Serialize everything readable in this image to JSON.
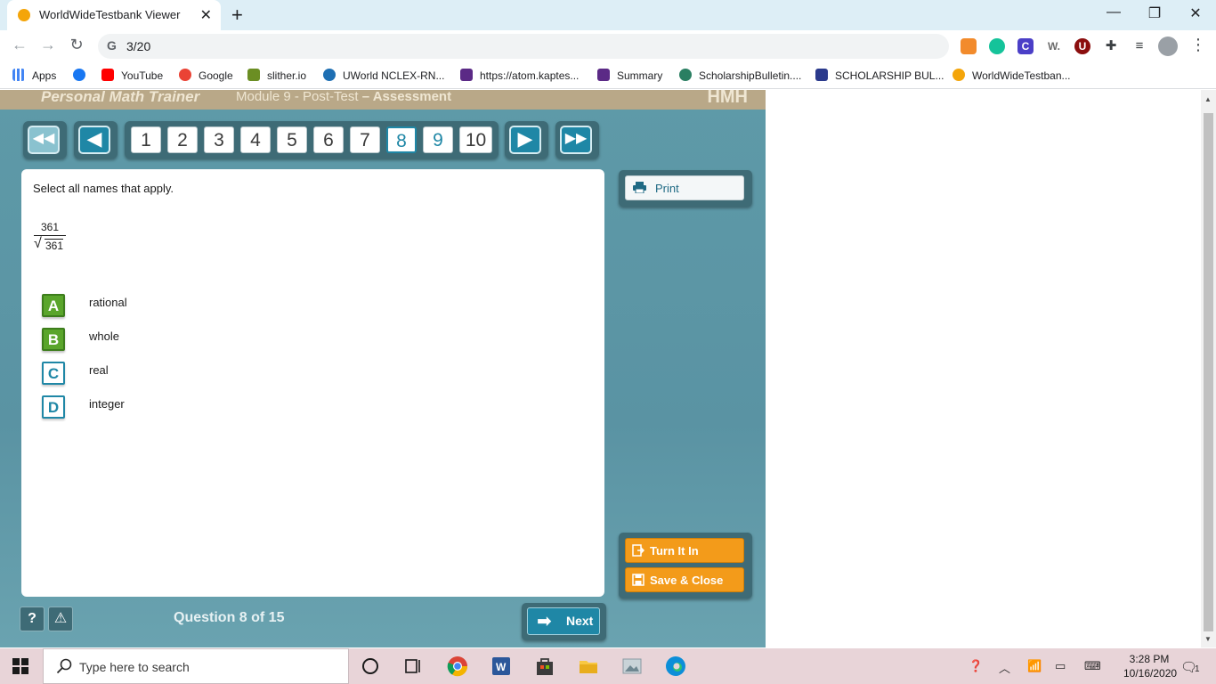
{
  "browser": {
    "tab_title": "WorldWideTestbank Viewer",
    "tab_close": "✕",
    "new_tab": "+",
    "address": "3/20",
    "omnibox_g": "G",
    "back": "←",
    "forward": "→",
    "reload": "↻",
    "minimize": "—",
    "restore": "❐",
    "close": "✕",
    "menu": "⋮"
  },
  "bookmarks": [
    {
      "label": "Apps",
      "color": "#4285f4"
    },
    {
      "label": "",
      "color": "#1877f2"
    },
    {
      "label": "YouTube",
      "color": "#ff0000"
    },
    {
      "label": "Google",
      "color": "#ea4335"
    },
    {
      "label": "slither.io",
      "color": "#6b8e23"
    },
    {
      "label": "UWorld NCLEX-RN...",
      "color": "#1e6fb3"
    },
    {
      "label": "https://atom.kaptes...",
      "color": "#5b2a86"
    },
    {
      "label": "Summary",
      "color": "#5b2a86"
    },
    {
      "label": "ScholarshipBulletin....",
      "color": "#2a7f62"
    },
    {
      "label": "SCHOLARSHIP BUL...",
      "color": "#2b3a8c"
    },
    {
      "label": "WorldWideTestban...",
      "color": "#f4a50a"
    }
  ],
  "app": {
    "product": "Personal Math Trainer",
    "module": "Module 9 - Post-Test",
    "mode": "– Assessment",
    "brand": "HMH",
    "rewind": "◀◀",
    "prev": "◀",
    "next_arrow": "▶",
    "fast_forward": "▶▶",
    "pages": [
      "1",
      "2",
      "3",
      "4",
      "5",
      "6",
      "7",
      "8",
      "9",
      "10"
    ],
    "current_page": "8",
    "prompt": "Select all names that apply.",
    "fraction_numerator": "361",
    "fraction_radical": "√",
    "fraction_denominator": "361",
    "options": [
      {
        "letter": "A",
        "label": "rational",
        "selected": true
      },
      {
        "letter": "B",
        "label": "whole",
        "selected": true
      },
      {
        "letter": "C",
        "label": "real",
        "selected": false
      },
      {
        "letter": "D",
        "label": "integer",
        "selected": false
      }
    ],
    "print_label": "Print",
    "turn_in_label": "Turn It In",
    "save_close_label": "Save & Close",
    "help": "?",
    "report": "⚠",
    "question_count": "Question 8 of 15",
    "next_label": "Next",
    "next_icon": "➡"
  },
  "colors": {
    "accent": "#1f87a6",
    "selected_option": "#5aa52b",
    "orange_button": "#f39b1a",
    "app_background": "#5e9aa8"
  },
  "taskbar": {
    "search_placeholder": "Type here to search",
    "time": "3:28 PM",
    "date": "10/16/2020",
    "notifications": "1"
  }
}
